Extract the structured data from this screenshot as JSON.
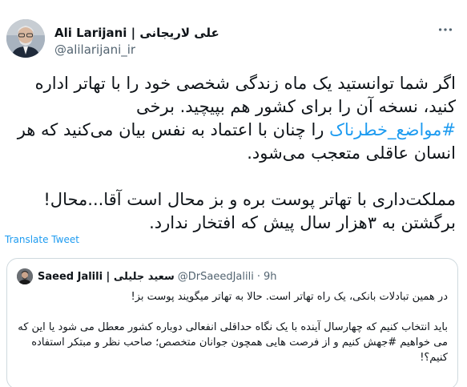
{
  "author": {
    "name": "Ali Larijani | علی لاریجانی",
    "handle": "@alilarijani_ir",
    "avatar_icon": "profile-photo"
  },
  "more_icon": "more-horizontal-icon",
  "tweet": {
    "p1_before": "اگر شما توانستید یک ماه زندگی شخصی خود را با تهاتر اداره کنید، نسخه آن را برای کشور هم بپیچید. برخی ",
    "p1_hashtag": "#مواضع_خطرناک",
    "p1_after": " را چنان با اعتماد به نفس بیان می‌کنید که هر انسان عاقلی متعجب می‌شود.",
    "p2": "مملکت‌داری با تهاتر پوست بره و بز محال است آقا...محال! برگشتن به ۳هزار سال پیش که افتخار ندارد."
  },
  "translate_label": "Translate Tweet",
  "quote": {
    "name": "Saeed Jalili | سعید جلیلی",
    "handle": "@DrSaeedJalili",
    "dot": "·",
    "time": "9h",
    "avatar_icon": "profile-photo",
    "p1": "در همین تبادلات بانکی، یک راه تهاتر است. حالا به تهاتر میگویند پوست بز!",
    "p2_before": "باید انتخاب کنیم که چهارسال آینده با یک نگاه حداقلی انفعالی دوباره کشور معطل می شود یا این که می خواهیم ",
    "p2_hashtag": "#جهش",
    "p2_after": " کنیم و از فرصت هایی همچون جوانان متخصص؛ صاحب نظر و مبتکر استفاده کنیم؟!"
  },
  "colors": {
    "link": "#1d9bf0",
    "text": "#0f1419",
    "secondary": "#536471",
    "border": "#cfd9de"
  }
}
